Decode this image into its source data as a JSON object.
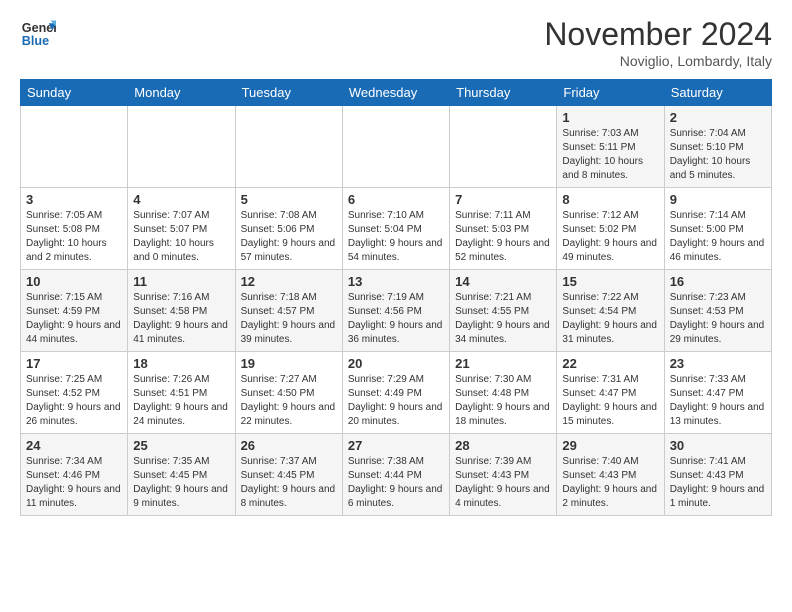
{
  "logo": {
    "line1": "General",
    "line2": "Blue"
  },
  "header": {
    "month": "November 2024",
    "location": "Noviglio, Lombardy, Italy"
  },
  "days_of_week": [
    "Sunday",
    "Monday",
    "Tuesday",
    "Wednesday",
    "Thursday",
    "Friday",
    "Saturday"
  ],
  "weeks": [
    [
      {
        "day": "",
        "info": ""
      },
      {
        "day": "",
        "info": ""
      },
      {
        "day": "",
        "info": ""
      },
      {
        "day": "",
        "info": ""
      },
      {
        "day": "",
        "info": ""
      },
      {
        "day": "1",
        "info": "Sunrise: 7:03 AM\nSunset: 5:11 PM\nDaylight: 10 hours and 8 minutes."
      },
      {
        "day": "2",
        "info": "Sunrise: 7:04 AM\nSunset: 5:10 PM\nDaylight: 10 hours and 5 minutes."
      }
    ],
    [
      {
        "day": "3",
        "info": "Sunrise: 7:05 AM\nSunset: 5:08 PM\nDaylight: 10 hours and 2 minutes."
      },
      {
        "day": "4",
        "info": "Sunrise: 7:07 AM\nSunset: 5:07 PM\nDaylight: 10 hours and 0 minutes."
      },
      {
        "day": "5",
        "info": "Sunrise: 7:08 AM\nSunset: 5:06 PM\nDaylight: 9 hours and 57 minutes."
      },
      {
        "day": "6",
        "info": "Sunrise: 7:10 AM\nSunset: 5:04 PM\nDaylight: 9 hours and 54 minutes."
      },
      {
        "day": "7",
        "info": "Sunrise: 7:11 AM\nSunset: 5:03 PM\nDaylight: 9 hours and 52 minutes."
      },
      {
        "day": "8",
        "info": "Sunrise: 7:12 AM\nSunset: 5:02 PM\nDaylight: 9 hours and 49 minutes."
      },
      {
        "day": "9",
        "info": "Sunrise: 7:14 AM\nSunset: 5:00 PM\nDaylight: 9 hours and 46 minutes."
      }
    ],
    [
      {
        "day": "10",
        "info": "Sunrise: 7:15 AM\nSunset: 4:59 PM\nDaylight: 9 hours and 44 minutes."
      },
      {
        "day": "11",
        "info": "Sunrise: 7:16 AM\nSunset: 4:58 PM\nDaylight: 9 hours and 41 minutes."
      },
      {
        "day": "12",
        "info": "Sunrise: 7:18 AM\nSunset: 4:57 PM\nDaylight: 9 hours and 39 minutes."
      },
      {
        "day": "13",
        "info": "Sunrise: 7:19 AM\nSunset: 4:56 PM\nDaylight: 9 hours and 36 minutes."
      },
      {
        "day": "14",
        "info": "Sunrise: 7:21 AM\nSunset: 4:55 PM\nDaylight: 9 hours and 34 minutes."
      },
      {
        "day": "15",
        "info": "Sunrise: 7:22 AM\nSunset: 4:54 PM\nDaylight: 9 hours and 31 minutes."
      },
      {
        "day": "16",
        "info": "Sunrise: 7:23 AM\nSunset: 4:53 PM\nDaylight: 9 hours and 29 minutes."
      }
    ],
    [
      {
        "day": "17",
        "info": "Sunrise: 7:25 AM\nSunset: 4:52 PM\nDaylight: 9 hours and 26 minutes."
      },
      {
        "day": "18",
        "info": "Sunrise: 7:26 AM\nSunset: 4:51 PM\nDaylight: 9 hours and 24 minutes."
      },
      {
        "day": "19",
        "info": "Sunrise: 7:27 AM\nSunset: 4:50 PM\nDaylight: 9 hours and 22 minutes."
      },
      {
        "day": "20",
        "info": "Sunrise: 7:29 AM\nSunset: 4:49 PM\nDaylight: 9 hours and 20 minutes."
      },
      {
        "day": "21",
        "info": "Sunrise: 7:30 AM\nSunset: 4:48 PM\nDaylight: 9 hours and 18 minutes."
      },
      {
        "day": "22",
        "info": "Sunrise: 7:31 AM\nSunset: 4:47 PM\nDaylight: 9 hours and 15 minutes."
      },
      {
        "day": "23",
        "info": "Sunrise: 7:33 AM\nSunset: 4:47 PM\nDaylight: 9 hours and 13 minutes."
      }
    ],
    [
      {
        "day": "24",
        "info": "Sunrise: 7:34 AM\nSunset: 4:46 PM\nDaylight: 9 hours and 11 minutes."
      },
      {
        "day": "25",
        "info": "Sunrise: 7:35 AM\nSunset: 4:45 PM\nDaylight: 9 hours and 9 minutes."
      },
      {
        "day": "26",
        "info": "Sunrise: 7:37 AM\nSunset: 4:45 PM\nDaylight: 9 hours and 8 minutes."
      },
      {
        "day": "27",
        "info": "Sunrise: 7:38 AM\nSunset: 4:44 PM\nDaylight: 9 hours and 6 minutes."
      },
      {
        "day": "28",
        "info": "Sunrise: 7:39 AM\nSunset: 4:43 PM\nDaylight: 9 hours and 4 minutes."
      },
      {
        "day": "29",
        "info": "Sunrise: 7:40 AM\nSunset: 4:43 PM\nDaylight: 9 hours and 2 minutes."
      },
      {
        "day": "30",
        "info": "Sunrise: 7:41 AM\nSunset: 4:43 PM\nDaylight: 9 hours and 1 minute."
      }
    ]
  ]
}
